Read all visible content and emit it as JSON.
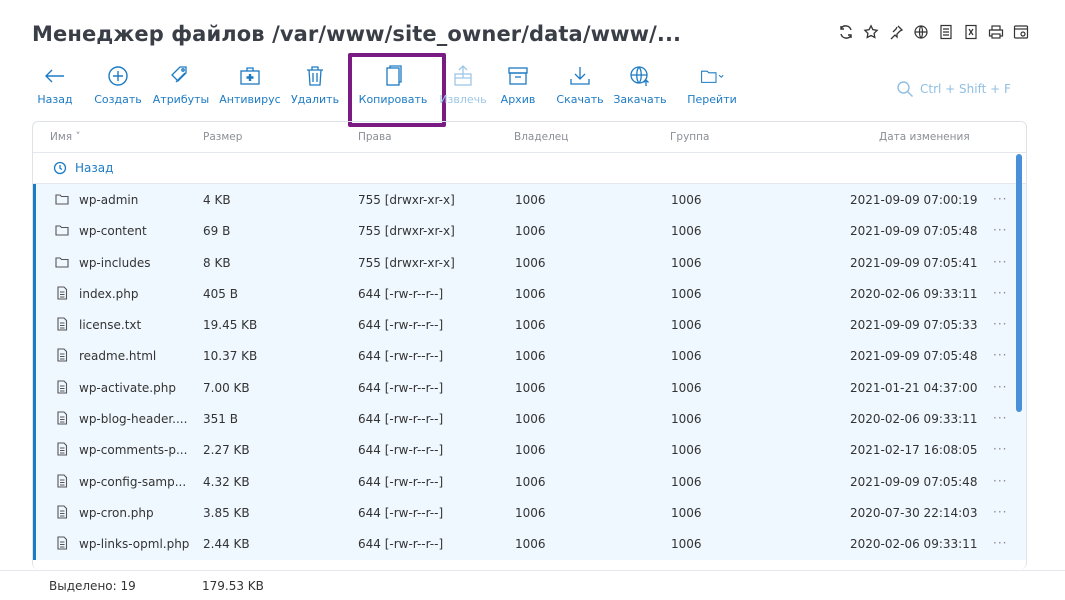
{
  "page_title": "Менеджер файлов /var/www/site_owner/data/www/...",
  "top_icons": [
    "refresh-icon",
    "star-icon",
    "pin-icon",
    "globe-icon",
    "document-icon",
    "book-icon",
    "print-icon",
    "window-icon"
  ],
  "toolbar": {
    "back": "Назад",
    "create": "Создать",
    "attributes": "Атрибуты",
    "antivirus": "Антивирус",
    "delete": "Удалить",
    "copy": "Копировать",
    "extract": "Извлечь",
    "archive": "Архив",
    "download": "Скачать",
    "fetch": "Закачать",
    "goto": "Перейти"
  },
  "search_hint": "Ctrl + Shift + F",
  "columns": {
    "name": "Имя",
    "size": "Размер",
    "rights": "Права",
    "owner": "Владелец",
    "group": "Группа",
    "modified": "Дата изменения"
  },
  "back_row": "Назад",
  "rows": [
    {
      "type": "folder",
      "name": "wp-admin",
      "size": "4 KB",
      "rights": "755 [drwxr-xr-x]",
      "owner": "1006",
      "group": "1006",
      "modified": "2021-09-09 07:00:19"
    },
    {
      "type": "folder",
      "name": "wp-content",
      "size": "69 B",
      "rights": "755 [drwxr-xr-x]",
      "owner": "1006",
      "group": "1006",
      "modified": "2021-09-09 07:05:48"
    },
    {
      "type": "folder",
      "name": "wp-includes",
      "size": "8 KB",
      "rights": "755 [drwxr-xr-x]",
      "owner": "1006",
      "group": "1006",
      "modified": "2021-09-09 07:05:41"
    },
    {
      "type": "file",
      "name": "index.php",
      "size": "405 B",
      "rights": "644 [-rw-r--r--]",
      "owner": "1006",
      "group": "1006",
      "modified": "2020-02-06 09:33:11"
    },
    {
      "type": "file",
      "name": "license.txt",
      "size": "19.45 KB",
      "rights": "644 [-rw-r--r--]",
      "owner": "1006",
      "group": "1006",
      "modified": "2021-09-09 07:05:33"
    },
    {
      "type": "file",
      "name": "readme.html",
      "size": "10.37 KB",
      "rights": "644 [-rw-r--r--]",
      "owner": "1006",
      "group": "1006",
      "modified": "2021-09-09 07:05:48"
    },
    {
      "type": "file",
      "name": "wp-activate.php",
      "size": "7.00 KB",
      "rights": "644 [-rw-r--r--]",
      "owner": "1006",
      "group": "1006",
      "modified": "2021-01-21 04:37:00"
    },
    {
      "type": "file",
      "name": "wp-blog-header....",
      "size": "351 B",
      "rights": "644 [-rw-r--r--]",
      "owner": "1006",
      "group": "1006",
      "modified": "2020-02-06 09:33:11"
    },
    {
      "type": "file",
      "name": "wp-comments-p...",
      "size": "2.27 KB",
      "rights": "644 [-rw-r--r--]",
      "owner": "1006",
      "group": "1006",
      "modified": "2021-02-17 16:08:05"
    },
    {
      "type": "file",
      "name": "wp-config-samp...",
      "size": "4.32 KB",
      "rights": "644 [-rw-r--r--]",
      "owner": "1006",
      "group": "1006",
      "modified": "2021-09-09 07:05:48"
    },
    {
      "type": "file",
      "name": "wp-cron.php",
      "size": "3.85 KB",
      "rights": "644 [-rw-r--r--]",
      "owner": "1006",
      "group": "1006",
      "modified": "2020-07-30 22:14:03"
    },
    {
      "type": "file",
      "name": "wp-links-opml.php",
      "size": "2.44 KB",
      "rights": "644 [-rw-r--r--]",
      "owner": "1006",
      "group": "1006",
      "modified": "2020-02-06 09:33:11"
    }
  ],
  "row_menu": "···",
  "footer": {
    "selected": "Выделено: 19",
    "total_size": "179.53 KB"
  },
  "colors": {
    "accent": "#1d7bc4",
    "highlight": "#7a1a83",
    "selected_row": "#f0f8ff"
  }
}
